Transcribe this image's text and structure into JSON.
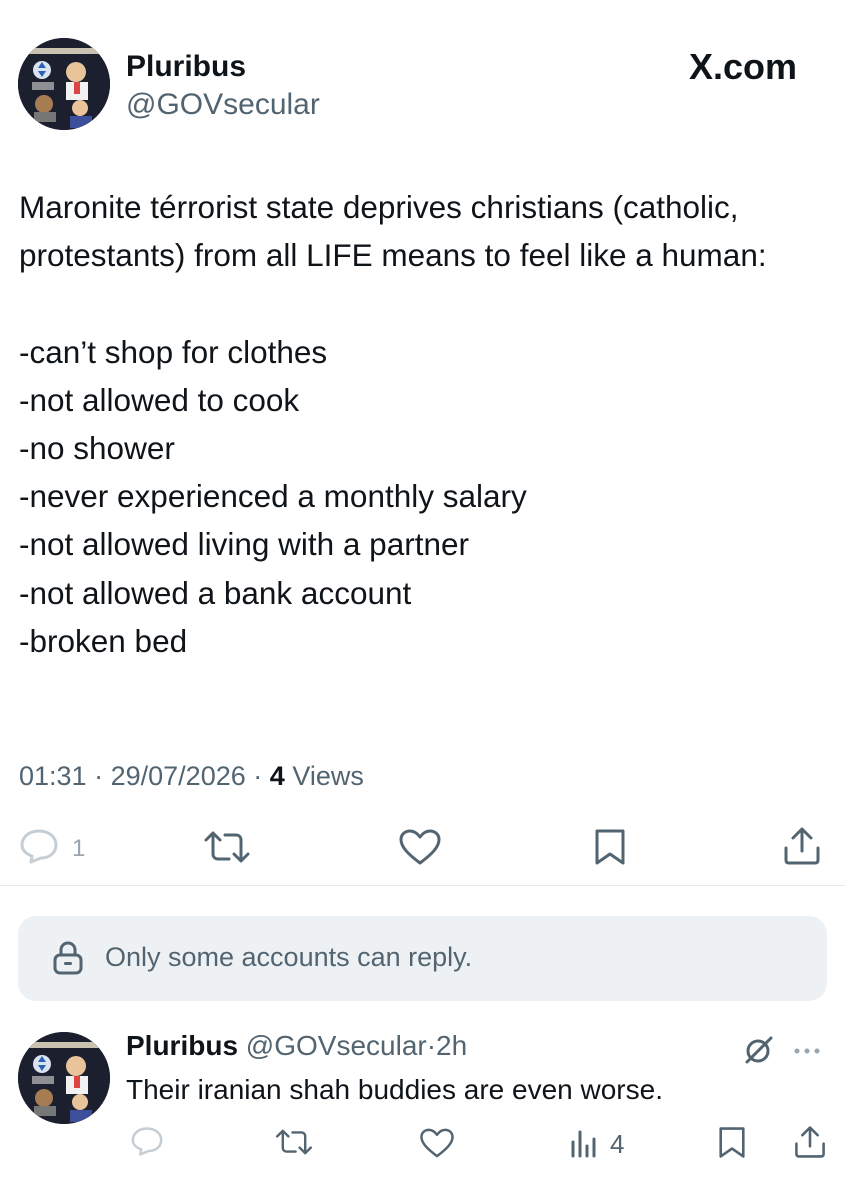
{
  "header": {
    "display_name": "Pluribus",
    "handle": "@GOVsecular",
    "source_label": "X.com"
  },
  "tweet": {
    "text": "Maronite térrorist state deprives christians (catholic, protestants) from all LIFE means to feel like a human:\n\n-can’t shop for clothes\n-not allowed to cook\n-no shower\n-never experienced a monthly salary\n-not allowed living with a partner\n-not allowed a bank account\n-broken bed",
    "time": "01:31",
    "separator": "·",
    "date": "29/07/2026",
    "views_count": "4",
    "views_label": "Views"
  },
  "actions": {
    "reply_count": "1",
    "icons": [
      "reply-icon",
      "retweet-icon",
      "like-icon",
      "bookmark-icon",
      "share-icon"
    ]
  },
  "restriction": {
    "text": "Only some accounts can reply.",
    "icon": "lock-icon"
  },
  "reply": {
    "display_name": "Pluribus",
    "handle": "@GOVsecular",
    "separator": "·",
    "time": "2h",
    "text": "Their iranian shah buddies are even worse.",
    "views_count": "4",
    "icons": [
      "grok-icon",
      "more-icon",
      "reply-icon",
      "retweet-icon",
      "like-icon",
      "views-icon",
      "bookmark-icon",
      "share-icon"
    ]
  },
  "colors": {
    "text": "#0f1419",
    "secondary": "#536471",
    "muted": "#9aa5b0",
    "restriction_bg": "#eef1f4"
  }
}
